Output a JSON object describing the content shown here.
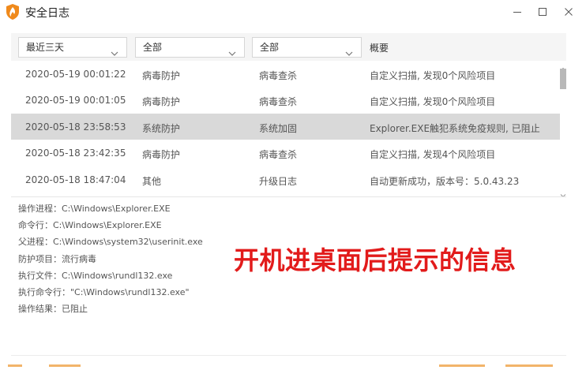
{
  "window": {
    "title": "安全日志",
    "icons": {
      "app": "flame-shield-icon",
      "minimize": "minimize-icon",
      "maximize": "maximize-icon",
      "close": "close-icon"
    }
  },
  "filters": {
    "time_range": "最近三天",
    "category": "全部",
    "subcategory": "全部",
    "summary_header": "概要"
  },
  "log_rows": [
    {
      "time": "2020-05-19 00:01:22",
      "type": "病毒防护",
      "sub": "病毒查杀",
      "summary": "自定义扫描, 发现0个风险项目",
      "selected": false
    },
    {
      "time": "2020-05-19 00:01:05",
      "type": "病毒防护",
      "sub": "病毒查杀",
      "summary": "自定义扫描, 发现0个风险项目",
      "selected": false
    },
    {
      "time": "2020-05-18 23:58:53",
      "type": "系统防护",
      "sub": "系统加固",
      "summary": "Explorer.EXE触犯系统免疫规则, 已阻止",
      "selected": true
    },
    {
      "time": "2020-05-18 23:42:35",
      "type": "病毒防护",
      "sub": "病毒查杀",
      "summary": "自定义扫描, 发现4个风险项目",
      "selected": false
    },
    {
      "time": "2020-05-18 18:47:04",
      "type": "其他",
      "sub": "升级日志",
      "summary": "自动更新成功，版本号：5.0.43.23",
      "selected": false
    }
  ],
  "details": [
    "操作进程：C:\\Windows\\Explorer.EXE",
    "命令行：C:\\Windows\\Explorer.EXE",
    "父进程：C:\\Windows\\system32\\userinit.exe",
    "防护项目：流行病毒",
    "执行文件：C:\\Windows\\rundl132.exe",
    "执行命令行：\"C:\\Windows\\rundl132.exe\"",
    "操作结果：已阻止"
  ],
  "annotation": "开机进桌面后提示的信息",
  "colors": {
    "selected_row": "#d9d9d9",
    "annotation": "#e21b1b",
    "brand_flame": "#f08a1c"
  }
}
